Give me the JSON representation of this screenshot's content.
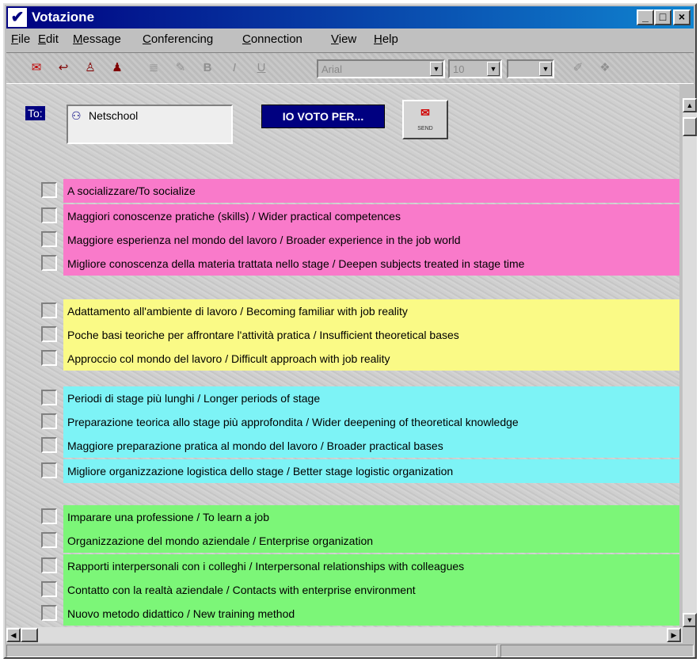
{
  "window": {
    "title": "Votazione",
    "icon": "check-icon"
  },
  "titlebar_buttons": [
    "minimize",
    "maximize",
    "close"
  ],
  "menu": [
    "File",
    "Edit",
    "Message",
    "Conferencing",
    "Connection",
    "View",
    "Help"
  ],
  "toolbar": {
    "font_name": "Arial",
    "font_size": "10",
    "buttons": [
      "send-icon",
      "reply-icon",
      "stamp-icon",
      "user-icon",
      "list-icon",
      "edit-icon",
      "bold-icon",
      "italic-icon",
      "underline-icon",
      "attach-icon",
      "style-icon"
    ]
  },
  "compose": {
    "to_label": "To:",
    "recipient": "Netschool",
    "header_label": "IO VOTO PER...",
    "send_label": "SEND"
  },
  "groups": [
    {
      "color": "#f97aca",
      "items": [
        "A socializzare/To socialize",
        "Maggiori conoscenze pratiche (skills) / Wider practical competences",
        "Maggiore esperienza nel mondo del lavoro / Broader experience in the job world",
        "Migliore conoscenza della materia trattata nello stage / Deepen subjects treated in stage time"
      ]
    },
    {
      "color": "#fafa86",
      "items": [
        "Adattamento all'ambiente di lavoro / Becoming familiar with job reality",
        "Poche basi teoriche per affrontare l'attività pratica / Insufficient theoretical bases",
        "Approccio col mondo del lavoro / Difficult approach with job reality"
      ]
    },
    {
      "color": "#7df3f6",
      "items": [
        "Periodi di stage più lunghi / Longer periods of stage",
        "Preparazione teorica allo stage più approfondita / Wider deepening of theoretical knowledge",
        "Maggiore preparazione pratica al mondo del lavoro / Broader practical bases",
        "Migliore organizzazione logistica dello stage / Better stage logistic organization"
      ]
    },
    {
      "color": "#7cf678",
      "items": [
        "Imparare una professione / To learn a job",
        "Organizzazione del mondo aziendale / Enterprise organization",
        "Rapporti interpersonali con i colleghi / Interpersonal relationships with colleagues",
        "Contatto con la realtà aziendale / Contacts with enterprise environment",
        "Nuovo metodo didattico / New training method"
      ]
    }
  ]
}
